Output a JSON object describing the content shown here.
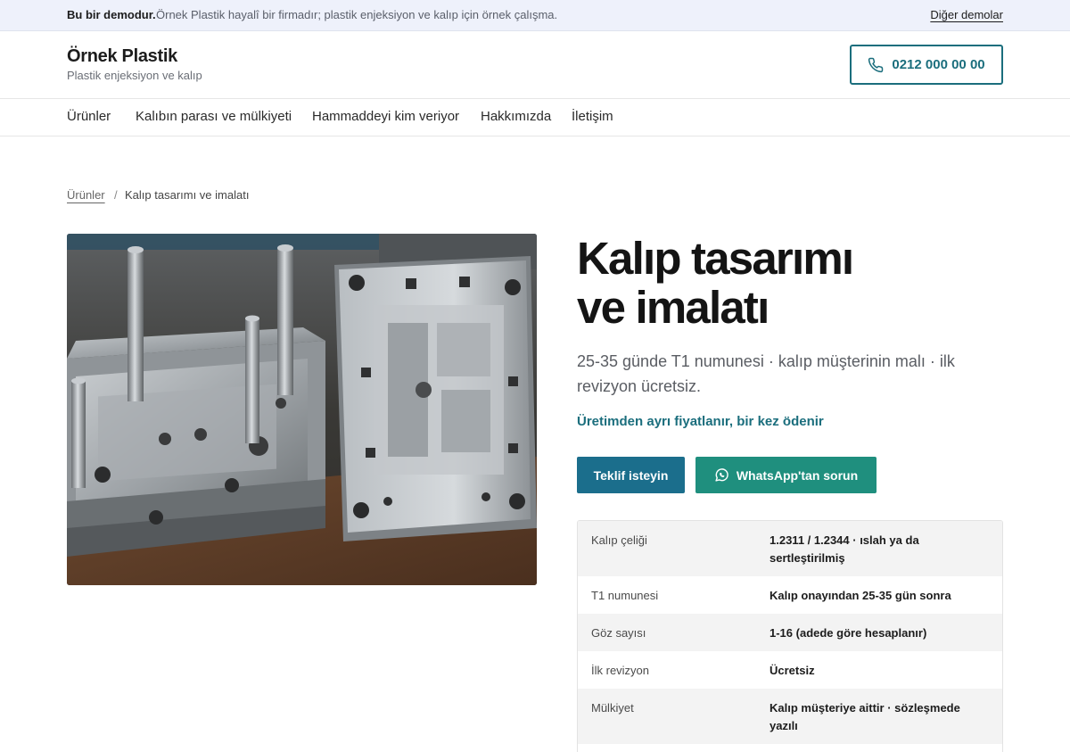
{
  "demo_bar": {
    "label": "Bu bir demodur.",
    "note": "Örnek Plastik hayalî bir firmadır; plastik enjeksiyon ve kalıp için örnek çalışma.",
    "other_demos": "Diğer demolar"
  },
  "header": {
    "brand": "Örnek Plastik",
    "tagline": "Plastik enjeksiyon ve kalıp",
    "phone": "0212 000 00 00",
    "phone_icon": "phone-icon"
  },
  "nav": {
    "items": [
      {
        "label": "Ürünler"
      },
      {
        "label": "Kalıbın parası ve mülkiyeti"
      },
      {
        "label": "Hammaddeyi kim veriyor"
      },
      {
        "label": "Hakkımızda"
      },
      {
        "label": "İletişim"
      }
    ]
  },
  "breadcrumb": {
    "parent": "Ürünler",
    "separator": "/",
    "current": "Kalıp tasarımı ve imalatı"
  },
  "product": {
    "title_line1": "Kalıp tasarımı",
    "title_line2": "ve imalatı",
    "subtitle": "25-35 günde T1 numunesi · kalıp müşterinin malı · ilk revizyon ücretsiz.",
    "pricing_note": "Üretimden ayrı fiyatlanır, bir kez ödenir",
    "quote_button": "Teklif isteyin",
    "whatsapp_button": "WhatsApp'tan sorun",
    "whatsapp_icon": "whatsapp-icon",
    "image_subject": "injection-mold-photo"
  },
  "specs": {
    "rows": [
      {
        "key": "Kalıp çeliği",
        "value": "1.2311 / 1.2344 · ıslah ya da sertleştirilmiş"
      },
      {
        "key": "T1 numunesi",
        "value": "Kalıp onayından 25-35 gün sonra"
      },
      {
        "key": "Göz sayısı",
        "value": "1-16 (adede göre hesaplanır)"
      },
      {
        "key": "İlk revizyon",
        "value": "Ücretsiz"
      },
      {
        "key": "Mülkiyet",
        "value": "Kalıp müşteriye aittir · sözleşmede yazılı"
      }
    ]
  },
  "colors": {
    "accent": "#1b6e7d",
    "primary_button": "#1b6e8c",
    "whatsapp_button": "#1f8f7e",
    "demo_bar_bg": "#eef1fb"
  }
}
